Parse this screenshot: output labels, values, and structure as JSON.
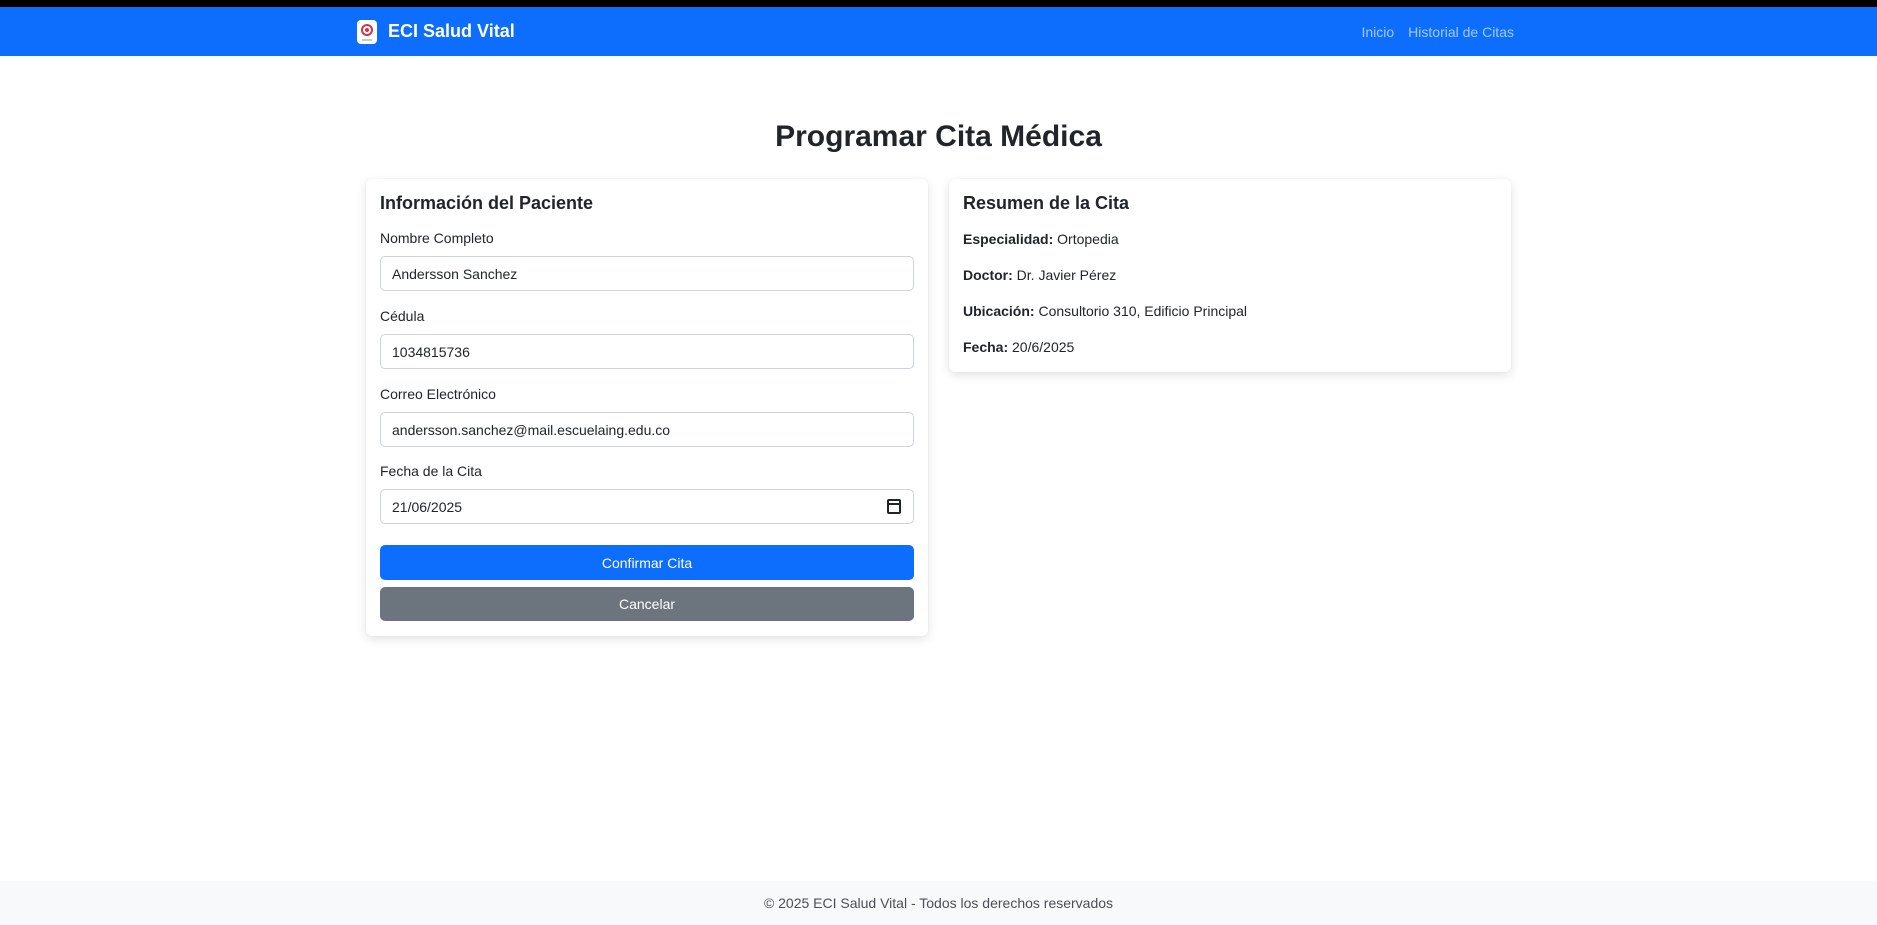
{
  "navbar": {
    "brand": "ECI Salud Vital",
    "brand_icon": "medical-logo-icon",
    "links": [
      {
        "label": "Inicio"
      },
      {
        "label": "Historial de Citas"
      }
    ],
    "bg_color": "#0d6efd"
  },
  "page": {
    "title": "Programar Cita Médica"
  },
  "patient_card": {
    "title": "Información del Paciente",
    "fields": {
      "name": {
        "label": "Nombre Completo",
        "value": "Andersson Sanchez"
      },
      "id": {
        "label": "Cédula",
        "value": "1034815736"
      },
      "email": {
        "label": "Correo Electrónico",
        "value": "andersson.sanchez@mail.escuelaing.edu.co"
      },
      "date": {
        "label": "Fecha de la Cita",
        "value": "21/06/2025"
      }
    },
    "confirm_label": "Confirmar Cita",
    "cancel_label": "Cancelar"
  },
  "summary_card": {
    "title": "Resumen de la Cita",
    "rows": [
      {
        "key": "Especialidad:",
        "value": "Ortopedia"
      },
      {
        "key": "Doctor:",
        "value": "Dr. Javier Pérez"
      },
      {
        "key": "Ubicación:",
        "value": "Consultorio 310, Edificio Principal"
      },
      {
        "key": "Fecha:",
        "value": "20/6/2025"
      }
    ]
  },
  "footer": {
    "text": "© 2025 ECI Salud Vital - Todos los derechos reservados"
  },
  "colors": {
    "primary": "#0d6efd",
    "secondary": "#6c757d",
    "footer_bg": "#f8f9fa"
  }
}
